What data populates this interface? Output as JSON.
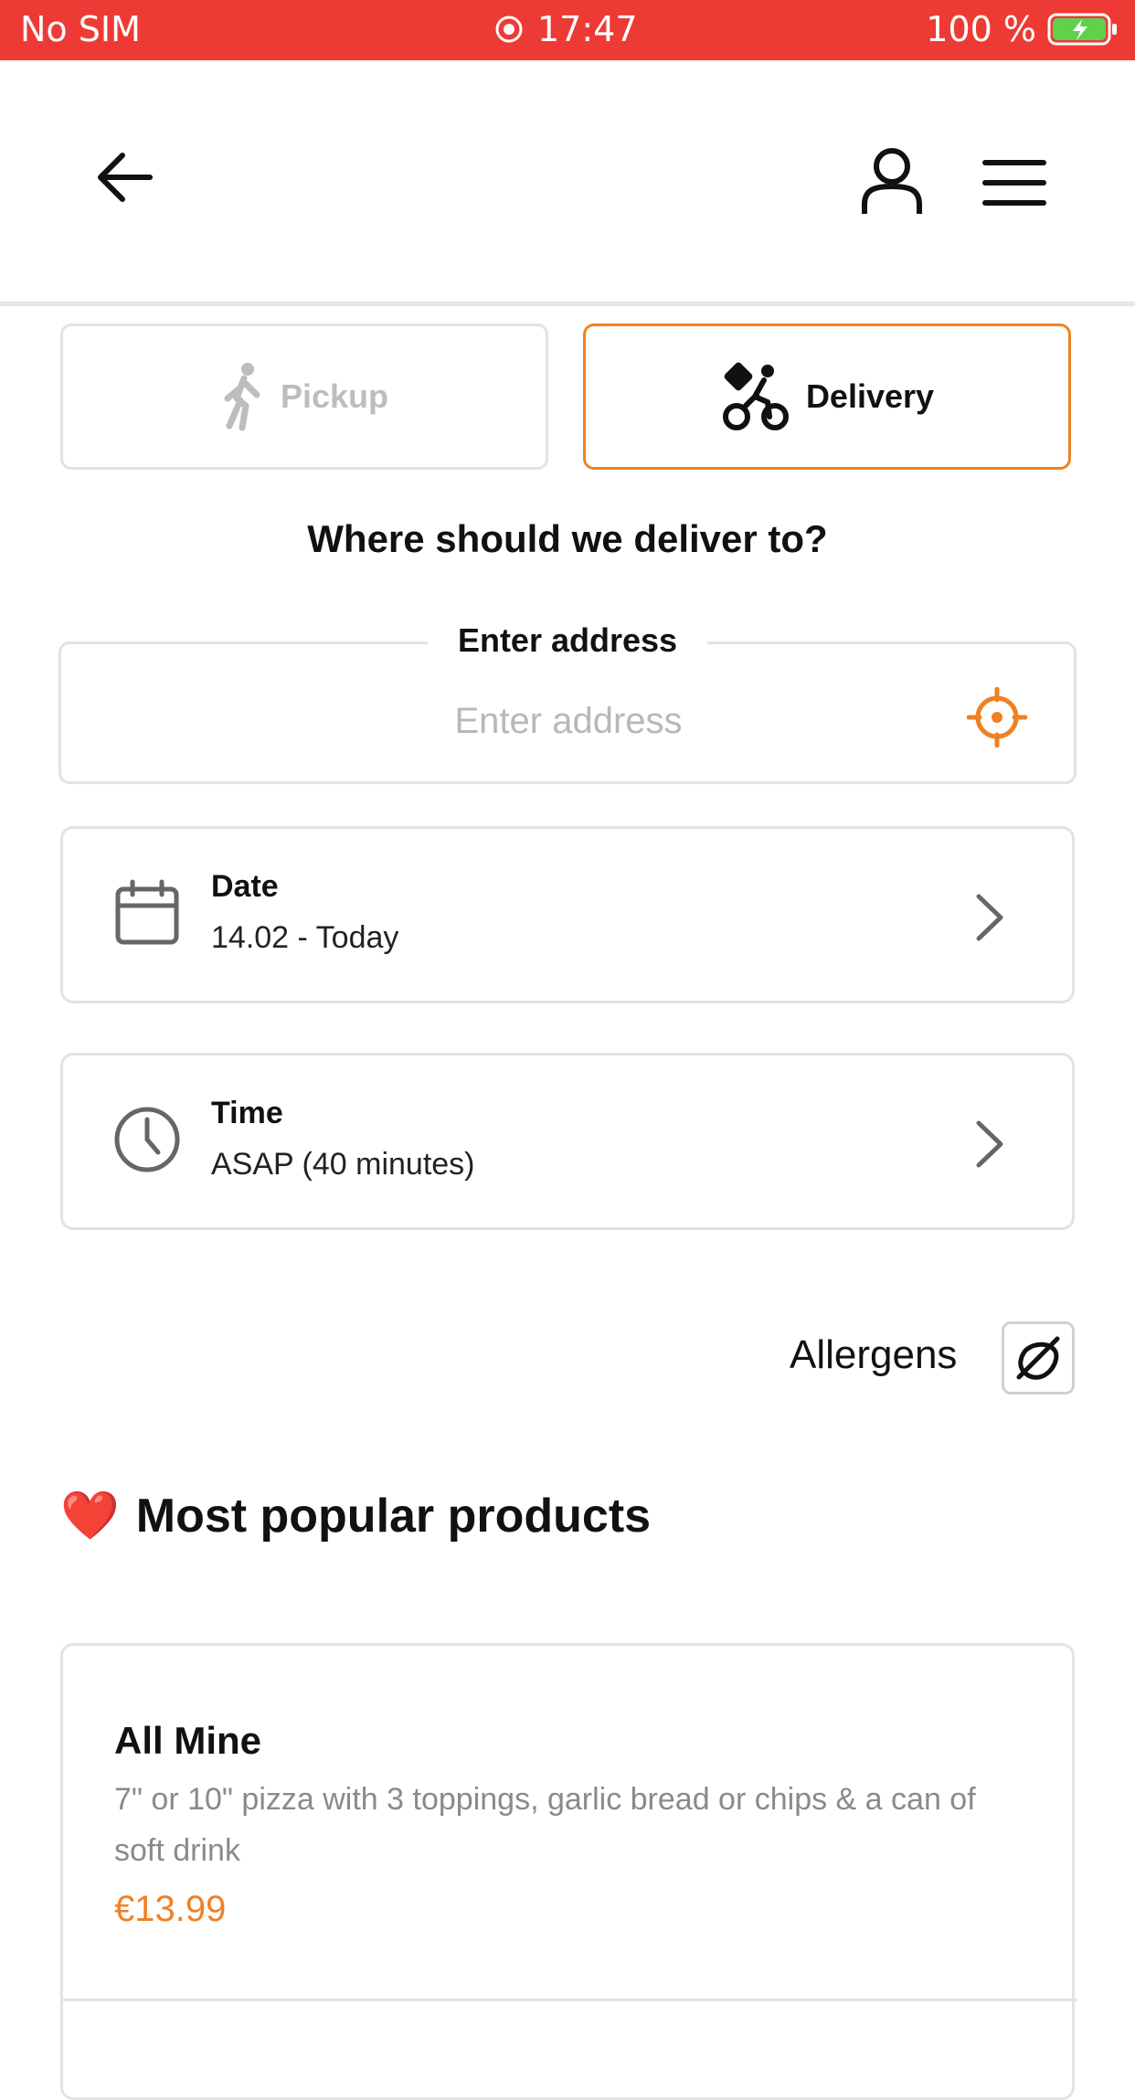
{
  "status_bar": {
    "carrier": "No SIM",
    "time": "17:47",
    "battery": "100 %"
  },
  "header": {
    "back": "back",
    "account": "account",
    "menu": "menu"
  },
  "mode": {
    "pickup_label": "Pickup",
    "delivery_label": "Delivery",
    "selected": "Delivery",
    "accent": "#f08123"
  },
  "question": "Where should we deliver to?",
  "address": {
    "legend": "Enter address",
    "placeholder": "Enter address",
    "value": ""
  },
  "date": {
    "label": "Date",
    "value": "14.02 - Today"
  },
  "time": {
    "label": "Time",
    "value": "ASAP (40 minutes)"
  },
  "allergens": {
    "label": "Allergens"
  },
  "popular": {
    "emoji": "❤️",
    "title": "Most popular products",
    "products": [
      {
        "name": "All Mine",
        "description": "7\" or 10\" pizza with 3 toppings, garlic bread or chips & a can of soft drink",
        "price": "€13.99"
      }
    ]
  },
  "colors": {
    "status_bar": "#ee3a34",
    "accent": "#f08123",
    "border": "#e3e3e3"
  }
}
